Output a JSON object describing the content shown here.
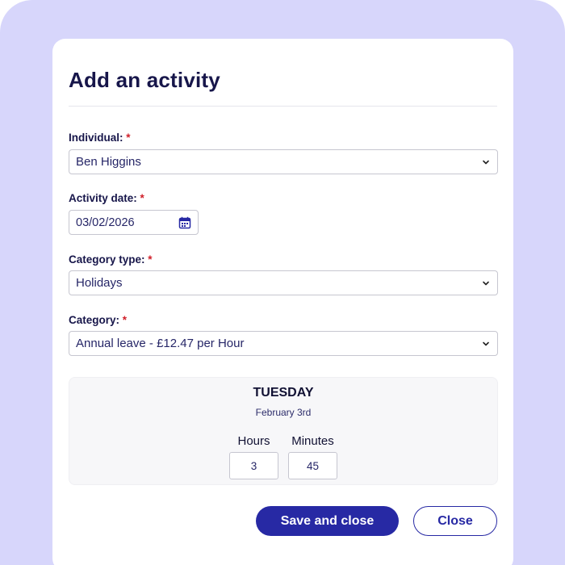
{
  "modal": {
    "title": "Add an activity"
  },
  "fields": {
    "individual": {
      "label": "Individual:",
      "required": "*",
      "value": "Ben Higgins"
    },
    "activity_date": {
      "label": "Activity date:",
      "required": "*",
      "value": "03/02/2026"
    },
    "category_type": {
      "label": "Category type:",
      "required": "*",
      "value": "Holidays"
    },
    "category": {
      "label": "Category:",
      "required": "*",
      "value": "Annual leave - £12.47 per Hour"
    }
  },
  "day_summary": {
    "weekday": "TUESDAY",
    "date": "February 3rd",
    "hours_label": "Hours",
    "hours_value": "3",
    "minutes_label": "Minutes",
    "minutes_value": "45"
  },
  "buttons": {
    "save": "Save and close",
    "close": "Close"
  },
  "icons": {
    "dropdown": "chevron-down-icon",
    "calendar": "calendar-icon"
  },
  "colors": {
    "background": "#d7d6fb",
    "primary": "#2729a4",
    "required": "#d0202a",
    "title": "#17164a"
  }
}
